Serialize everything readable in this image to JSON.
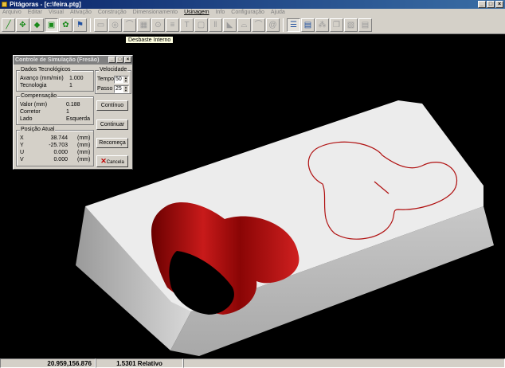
{
  "window": {
    "title": "Pitágoras - [c:\\feira.ptg]"
  },
  "menu": [
    "Arquivo",
    "Editar",
    "Visual",
    "Ativação",
    "Construção",
    "Dimensionamento",
    "Usinagem",
    "Info",
    "Configuração",
    "Ajuda"
  ],
  "menu_active": "Usinagem",
  "tooltip": "Desbaste Interno",
  "dialog": {
    "title": "Controle de Simulação (Fresão)",
    "dados_label": "Dados Tecnológicos",
    "avanco_label": "Avanço (mm/min)",
    "avanco_value": "1.000",
    "tecnologia_label": "Tecnologia",
    "tecnologia_value": "1",
    "velocidade_label": "Velocidade",
    "tempo_label": "Tempo",
    "tempo_value": "50",
    "passo_label": "Passo",
    "passo_value": "25",
    "compensacao_label": "Compensação",
    "valor_label": "Valor (mm)",
    "valor_value": "0.188",
    "corretor_label": "Corretor",
    "corretor_value": "1",
    "lado_label": "Lado",
    "lado_value": "Esquerda",
    "posicao_label": "Posição Atual",
    "positions": [
      {
        "axis": "X",
        "value": "38.744",
        "unit": "(mm)"
      },
      {
        "axis": "Y",
        "value": "-25.703",
        "unit": "(mm)"
      },
      {
        "axis": "U",
        "value": "0.000",
        "unit": "(mm)"
      },
      {
        "axis": "V",
        "value": "0.000",
        "unit": "(mm)"
      }
    ],
    "btn_continuo": "Contínuo",
    "btn_continuar": "Continuar",
    "btn_recomeca": "Recomeça",
    "btn_cancela": "Cancela"
  },
  "status": {
    "coords": "20.959,156.876",
    "zoom": "1.5301 Relativo"
  },
  "colors": {
    "cut": "#b01010",
    "titlebar": "#0a246a",
    "panel": "#d4d0c8"
  }
}
